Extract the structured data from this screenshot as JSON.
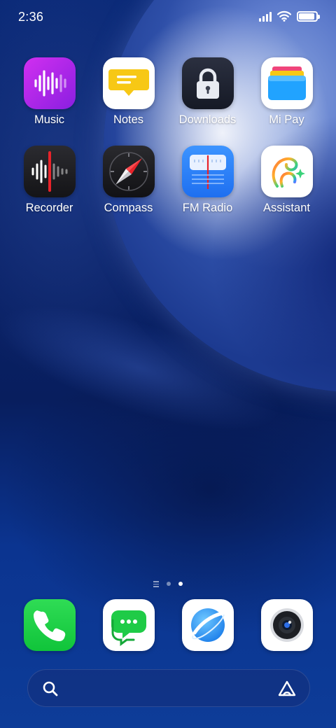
{
  "status_bar": {
    "time": "2:36",
    "battery_level": 0.92,
    "signal_bars": 4,
    "wifi": true
  },
  "apps": [
    [
      {
        "label": "Music",
        "icon": "music-icon"
      },
      {
        "label": "Notes",
        "icon": "notes-icon"
      },
      {
        "label": "Downloads",
        "icon": "downloads-lock-icon"
      },
      {
        "label": "Mi Pay",
        "icon": "wallet-icon"
      }
    ],
    [
      {
        "label": "Recorder",
        "icon": "recorder-icon"
      },
      {
        "label": "Compass",
        "icon": "compass-icon"
      },
      {
        "label": "FM Radio",
        "icon": "radio-icon"
      },
      {
        "label": "Assistant",
        "icon": "assistant-icon"
      }
    ]
  ],
  "pages": {
    "count": 2,
    "current": 2
  },
  "dock": [
    {
      "icon": "phone-icon"
    },
    {
      "icon": "messages-icon"
    },
    {
      "icon": "browser-icon"
    },
    {
      "icon": "camera-icon"
    }
  ],
  "search_bar": {
    "icon": "search-icon",
    "right_icon": "assistant-triangle-icon"
  },
  "colors": {
    "music": "#b12aea",
    "notes_yellow": "#f7c815",
    "phone_green": "#1fd146",
    "fm_blue": "#2b80fa",
    "recorder_red": "#e8232a"
  }
}
